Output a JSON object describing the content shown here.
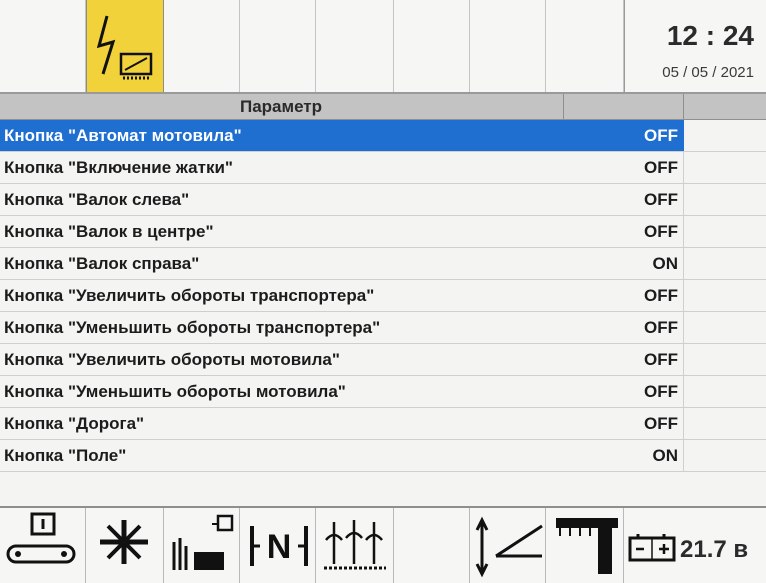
{
  "clock": {
    "time": "12 : 24",
    "date": "05 / 05 / 2021"
  },
  "table": {
    "header": "Параметр",
    "rows": [
      {
        "label": "Кнопка \"Автомат мотовила\"",
        "value": "OFF",
        "selected": true
      },
      {
        "label": "Кнопка \"Включение жатки\"",
        "value": "OFF"
      },
      {
        "label": "Кнопка \"Валок слева\"",
        "value": "OFF"
      },
      {
        "label": "Кнопка \"Валок в центре\"",
        "value": "OFF"
      },
      {
        "label": "Кнопка \"Валок справа\"",
        "value": "ON"
      },
      {
        "label": "Кнопка \"Увеличить обороты транспортера\"",
        "value": "OFF"
      },
      {
        "label": "Кнопка \"Уменьшить обороты транспортера\"",
        "value": "OFF"
      },
      {
        "label": "Кнопка \"Увеличить обороты мотовила\"",
        "value": "OFF"
      },
      {
        "label": "Кнопка \"Уменьшить обороты мотовила\"",
        "value": "OFF"
      },
      {
        "label": "Кнопка \"Дорога\"",
        "value": "OFF"
      },
      {
        "label": "Кнопка \"Поле\"",
        "value": "ON"
      }
    ]
  },
  "warning": {
    "icon": "electrical-warning-icon",
    "color": "#f2d23a"
  },
  "bottombar": {
    "icons": [
      "conveyor-icon",
      "reel-fan-icon",
      "header-unload-icon",
      "neutral-icon",
      "crop-field-icon",
      "blank",
      "header-height-icon",
      "header-tilt-icon"
    ],
    "battery_voltage": "21.7 в"
  },
  "colors": {
    "selection": "#1f6fd1",
    "header_bg": "#c3c3c3",
    "warning": "#f2d23a"
  }
}
